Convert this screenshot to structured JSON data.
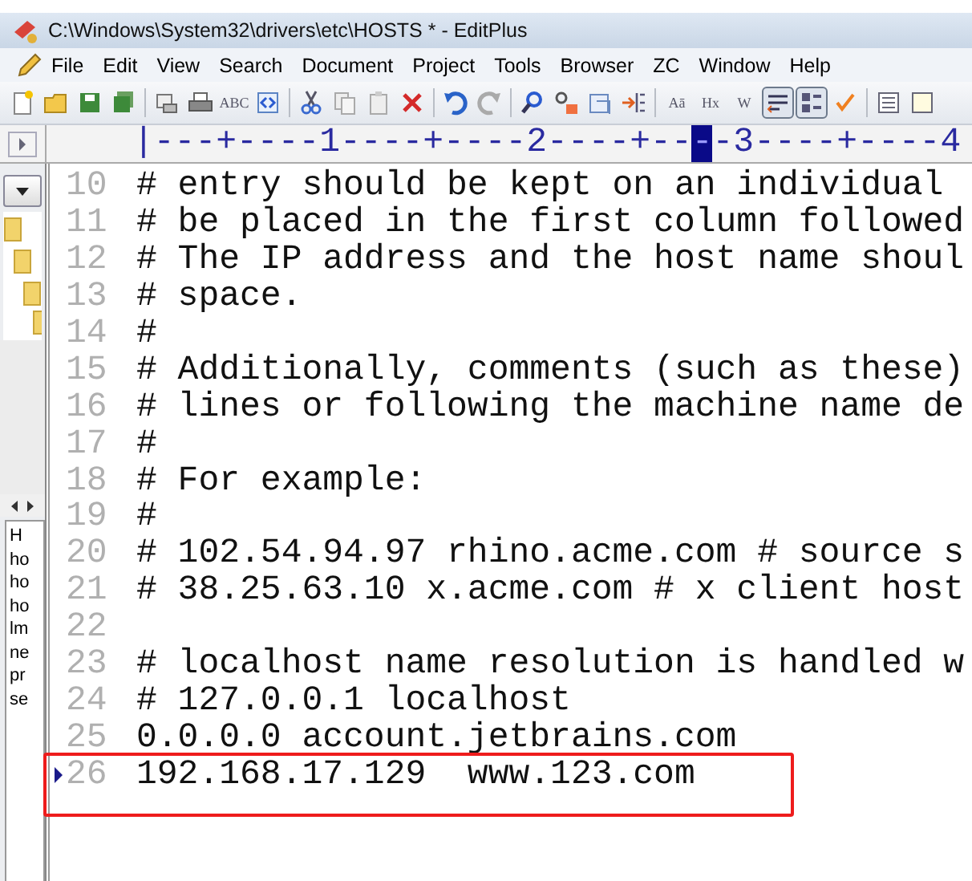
{
  "window": {
    "title": "C:\\Windows\\System32\\drivers\\etc\\HOSTS * - EditPlus"
  },
  "menu": [
    "File",
    "Edit",
    "View",
    "Search",
    "Document",
    "Project",
    "Tools",
    "Browser",
    "ZC",
    "Window",
    "Help"
  ],
  "toolbar": [
    {
      "kind": "button"
    },
    {
      "kind": "button"
    },
    {
      "kind": "button"
    },
    {
      "kind": "button"
    },
    {
      "kind": "button"
    },
    {
      "kind": "button"
    },
    {
      "kind": "button",
      "label": "ABC"
    },
    {
      "kind": "button"
    },
    {
      "kind": "button"
    },
    {
      "kind": "button"
    },
    {
      "kind": "button"
    },
    {
      "kind": "button"
    },
    {
      "kind": "button"
    },
    {
      "kind": "button"
    },
    {
      "kind": "button"
    },
    {
      "kind": "button"
    },
    {
      "kind": "button"
    },
    {
      "kind": "button"
    },
    {
      "kind": "button",
      "label": "Aā"
    },
    {
      "kind": "button",
      "label": "Hx"
    },
    {
      "kind": "button",
      "label": "W"
    },
    {
      "kind": "toggle",
      "pressed": true
    },
    {
      "kind": "toggle",
      "pressed": true
    },
    {
      "kind": "button"
    },
    {
      "kind": "button"
    },
    {
      "kind": "button"
    }
  ],
  "ruler": [
    {
      "text": "|---+----1----+----2----+--",
      "current": false
    },
    {
      "text": "-",
      "current": true
    },
    {
      "text": "-3----+----4",
      "current": false
    }
  ],
  "sidebar": {
    "files": [
      "H",
      "ho",
      "ho",
      "ho",
      "lm",
      "ne",
      "pr",
      "se"
    ]
  },
  "lines": [
    {
      "number": "10",
      "text": "# entry should be kept on an individual",
      "current": false,
      "boxed": false
    },
    {
      "number": "11",
      "text": "# be placed in the first column followed",
      "current": false,
      "boxed": false
    },
    {
      "number": "12",
      "text": "# The IP address and the host name shoul",
      "current": false,
      "boxed": false
    },
    {
      "number": "13",
      "text": "# space.",
      "current": false,
      "boxed": false
    },
    {
      "number": "14",
      "text": "#",
      "current": false,
      "boxed": false
    },
    {
      "number": "15",
      "text": "# Additionally, comments (such as these)",
      "current": false,
      "boxed": false
    },
    {
      "number": "16",
      "text": "# lines or following the machine name de",
      "current": false,
      "boxed": false
    },
    {
      "number": "17",
      "text": "#",
      "current": false,
      "boxed": false
    },
    {
      "number": "18",
      "text": "# For example:",
      "current": false,
      "boxed": false
    },
    {
      "number": "19",
      "text": "#",
      "current": false,
      "boxed": false
    },
    {
      "number": "20",
      "text": "# 102.54.94.97 rhino.acme.com # source s",
      "current": false,
      "boxed": false
    },
    {
      "number": "21",
      "text": "# 38.25.63.10 x.acme.com # x client host",
      "current": false,
      "boxed": false
    },
    {
      "number": "22",
      "current": false,
      "boxed": false
    },
    {
      "number": "23",
      "text": "# localhost name resolution is handled w",
      "current": false,
      "boxed": false
    },
    {
      "number": "24",
      "text": "# 127.0.0.1 localhost",
      "current": false,
      "boxed": false
    },
    {
      "number": "25",
      "text": "0.0.0.0 account.jetbrains.com",
      "current": false,
      "boxed": false
    },
    {
      "number": "26",
      "text": "192.168.17.129  www.123.com",
      "current": true,
      "boxed": true
    }
  ]
}
